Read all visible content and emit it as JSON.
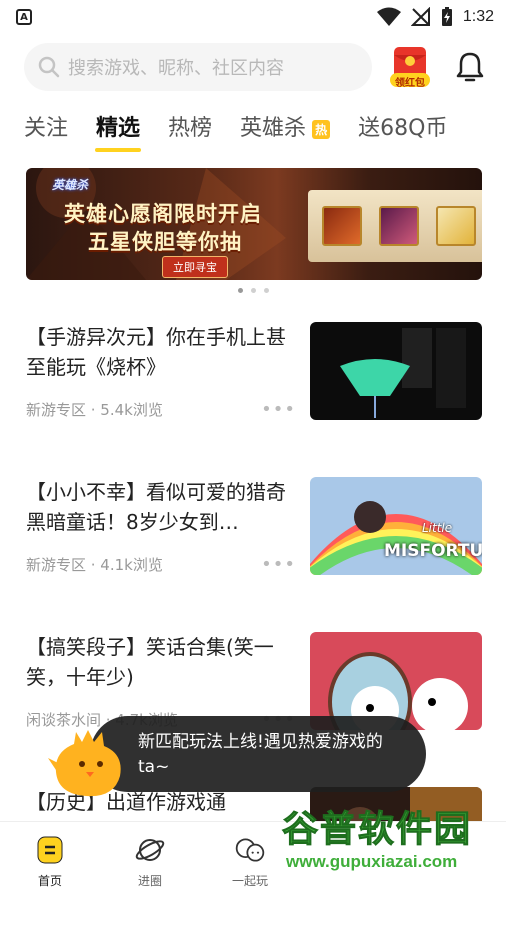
{
  "status_bar": {
    "left_icon": "notification-a-icon",
    "time": "1:32"
  },
  "header": {
    "search_placeholder": "搜索游戏、昵称、社区内容",
    "redpacket_label": "领红包"
  },
  "tabs": [
    {
      "label": "关注",
      "active": false
    },
    {
      "label": "精选",
      "active": true
    },
    {
      "label": "热榜",
      "active": false
    },
    {
      "label": "英雄杀",
      "active": false,
      "badge": "热"
    },
    {
      "label": "送68Q币",
      "active": false
    }
  ],
  "banner": {
    "logo_text": "英雄杀",
    "title_line1": "英雄心愿阁限时开启",
    "title_line2": "五星侠胆等你抽",
    "button": "立即寻宝",
    "page_count": 3,
    "active_page": 1
  },
  "feed": [
    {
      "title": "【手游异次元】你在手机上甚至能玩《烧杯》",
      "meta": "新游专区 · 5.4k浏览",
      "more": "•••"
    },
    {
      "title": "【小小不幸】看似可爱的猎奇黑暗童话！8岁少女到…",
      "meta": "新游专区 · 4.1k浏览",
      "more": "•••",
      "thumb_text_1": "Little",
      "thumb_text_2": "MISFORTUNE"
    },
    {
      "title": "【搞笑段子】笑话合集(笑一笑，十年少)",
      "meta": "闲谈茶水间 · 4.7k浏览",
      "more": "•••"
    },
    {
      "title": "【历史】出道作游戏通鉴：“光荣”的前世今生与…",
      "meta": "",
      "more": ""
    }
  ],
  "toast": {
    "text": "新匹配玩法上线!遇见热爱游戏的ta~"
  },
  "bottom_nav": [
    {
      "label": "首页",
      "icon": "home-icon",
      "active": true
    },
    {
      "label": "进圈",
      "icon": "planet-icon",
      "active": false
    },
    {
      "label": "一起玩",
      "icon": "chat-bubbles-icon",
      "active": false
    }
  ],
  "watermark": {
    "title": "谷普软件园",
    "url": "www.gupuxiazai.com"
  },
  "colors": {
    "accent_yellow": "#ffd21f",
    "text_dark": "#222222",
    "text_gray": "#999999"
  }
}
